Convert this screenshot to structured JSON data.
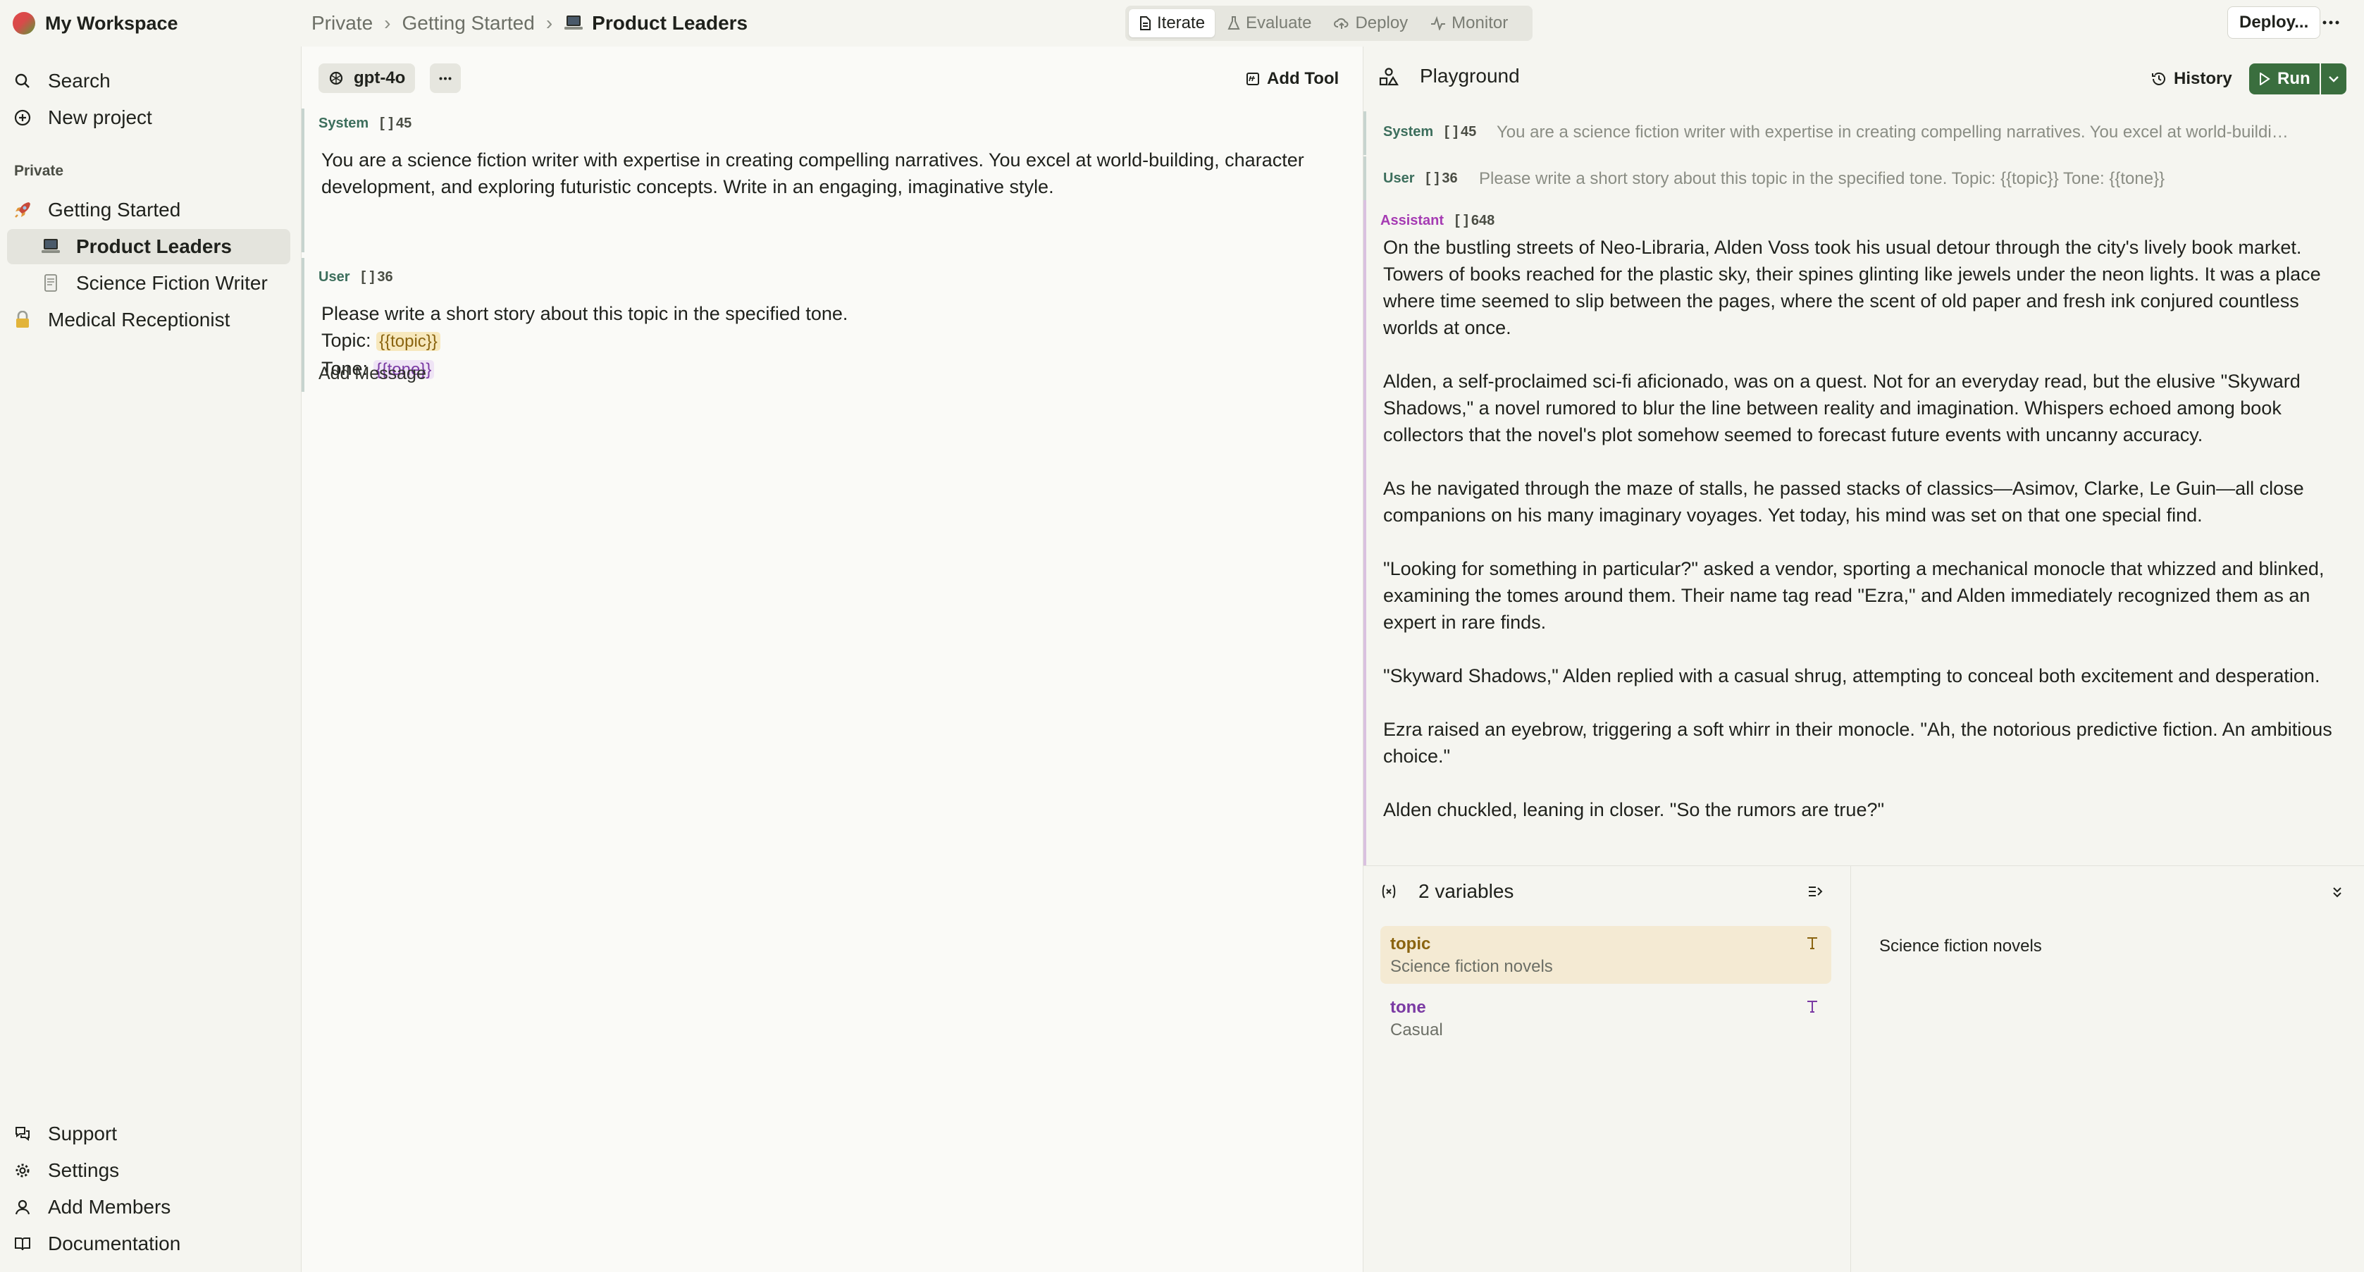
{
  "workspace": {
    "name": "My Workspace"
  },
  "breadcrumb": {
    "items": [
      "Private",
      "Getting Started"
    ],
    "current": "Product Leaders"
  },
  "modes": [
    {
      "label": "Iterate",
      "icon": "document-icon",
      "active": true
    },
    {
      "label": "Evaluate",
      "icon": "flask-icon",
      "active": false
    },
    {
      "label": "Deploy",
      "icon": "cloud-upload-icon",
      "active": false
    },
    {
      "label": "Monitor",
      "icon": "activity-icon",
      "active": false
    }
  ],
  "toolbar": {
    "deploy_label": "Deploy..."
  },
  "sidebar": {
    "search": "Search",
    "new_project": "New project",
    "section": "Private",
    "items": [
      {
        "label": "Getting Started",
        "icon": "rocket-icon"
      },
      {
        "label": "Product Leaders",
        "icon": "laptop-icon",
        "selected": true
      },
      {
        "label": "Science Fiction Writer",
        "icon": "file-icon"
      },
      {
        "label": "Medical Receptionist",
        "icon": "lock-icon"
      }
    ],
    "footer": [
      "Support",
      "Settings",
      "Add Members",
      "Documentation"
    ]
  },
  "editor": {
    "model": "gpt-4o",
    "add_tool": "Add Tool",
    "messages": [
      {
        "role": "System",
        "tokens": "45",
        "text": "You are a science fiction writer with expertise in creating compelling narratives. You excel at world-building, character development, and exploring futuristic concepts. Write in an engaging, imaginative style."
      },
      {
        "role": "User",
        "tokens": "36",
        "line1": "Please write a short story about this topic in the specified tone.",
        "topic_label": "Topic:",
        "topic_var": "{{topic}}",
        "tone_label": "Tone:",
        "tone_var": "{{tone}}"
      }
    ],
    "add_message": "Add Message"
  },
  "playground": {
    "title": "Playground",
    "history": "History",
    "run": "Run",
    "system": {
      "role": "System",
      "tokens": "45",
      "preview": "You are a science fiction writer with expertise in creating compelling narratives. You excel at world-building, ..."
    },
    "user": {
      "role": "User",
      "tokens": "36",
      "preview": "Please write a short story about this topic in the specified tone. Topic: {{topic}} Tone: {{tone}}"
    },
    "assistant": {
      "role": "Assistant",
      "tokens": "648",
      "paragraphs": [
        "On the bustling streets of Neo-Libraria, Alden Voss took his usual detour through the city's lively book market. Towers of books reached for the plastic sky, their spines glinting like jewels under the neon lights. It was a place where time seemed to slip between the pages, where the scent of old paper and fresh ink conjured countless worlds at once.",
        "Alden, a self-proclaimed sci-fi aficionado, was on a quest. Not for an everyday read, but the elusive \"Skyward Shadows,\" a novel rumored to blur the line between reality and imagination. Whispers echoed among book collectors that the novel's plot somehow seemed to forecast future events with uncanny accuracy.",
        "As he navigated through the maze of stalls, he passed stacks of classics—Asimov, Clarke, Le Guin—all close companions on his many imaginary voyages. Yet today, his mind was set on that one special find.",
        "\"Looking for something in particular?\" asked a vendor, sporting a mechanical monocle that whizzed and blinked, examining the tomes around them. Their name tag read \"Ezra,\" and Alden immediately recognized them as an expert in rare finds.",
        "\"Skyward Shadows,\" Alden replied with a casual shrug, attempting to conceal both excitement and desperation.",
        "Ezra raised an eyebrow, triggering a soft whirr in their monocle. \"Ah, the notorious predictive fiction. An ambitious choice.\"",
        "Alden chuckled, leaning in closer. \"So the rumors are true?\""
      ]
    },
    "variables": {
      "count_label": "2 variables",
      "items": [
        {
          "name": "topic",
          "value": "Science fiction novels",
          "color": "#8a6410"
        },
        {
          "name": "tone",
          "value": "Casual",
          "color": "#7a3aa3"
        }
      ],
      "detail_value": "Science fiction novels"
    }
  }
}
